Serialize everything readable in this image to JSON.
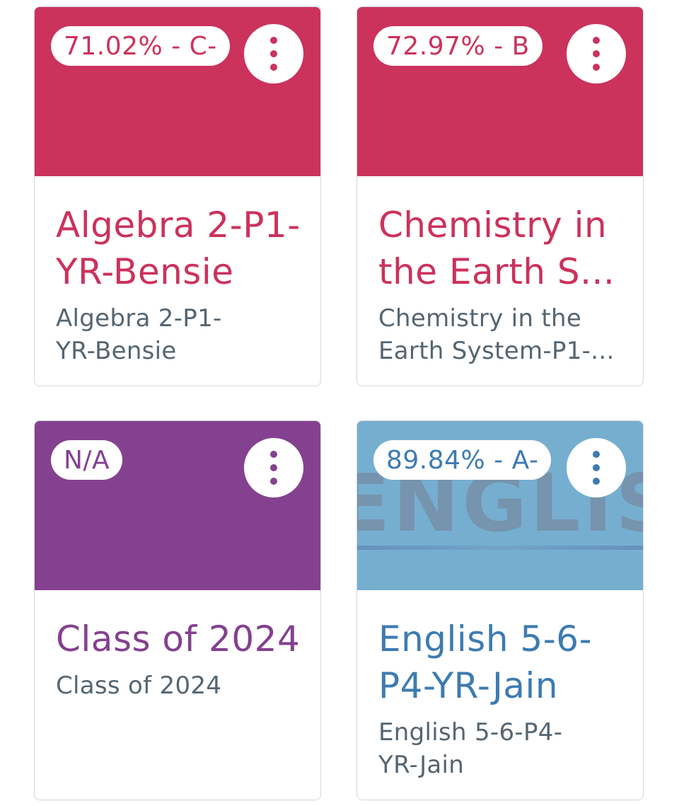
{
  "cards": [
    {
      "grade": "71.02% - C-",
      "title_line1": "Algebra 2-P1-",
      "title_line2": "YR-Bensie",
      "subtitle_line1": "Algebra 2-P1-",
      "subtitle_line2": "YR-Bensie",
      "color": "#cb325c",
      "menu_icon": "more-vertical-icon"
    },
    {
      "grade": "72.97% - B",
      "title_line1": "Chemistry in",
      "title_line2": "the Earth S...",
      "subtitle_line1": "Chemistry in the",
      "subtitle_line2": "Earth System-P1-...",
      "color": "#cb325c",
      "menu_icon": "more-vertical-icon"
    },
    {
      "grade": "N/A",
      "title_line1": "Class of 2024",
      "subtitle_line1": "Class of 2024",
      "color": "#84418f",
      "menu_icon": "more-vertical-icon"
    },
    {
      "grade": "89.84% - A-",
      "title_line1": "English 5-6-",
      "title_line2": "P4-YR-Jain",
      "subtitle_line1": "English 5-6-P4-",
      "subtitle_line2": "YR-Jain",
      "color": "#3d7bb1",
      "hero_bg": "#76aed0",
      "hero_image_text": "ENGLISH",
      "menu_icon": "more-vertical-icon"
    }
  ]
}
